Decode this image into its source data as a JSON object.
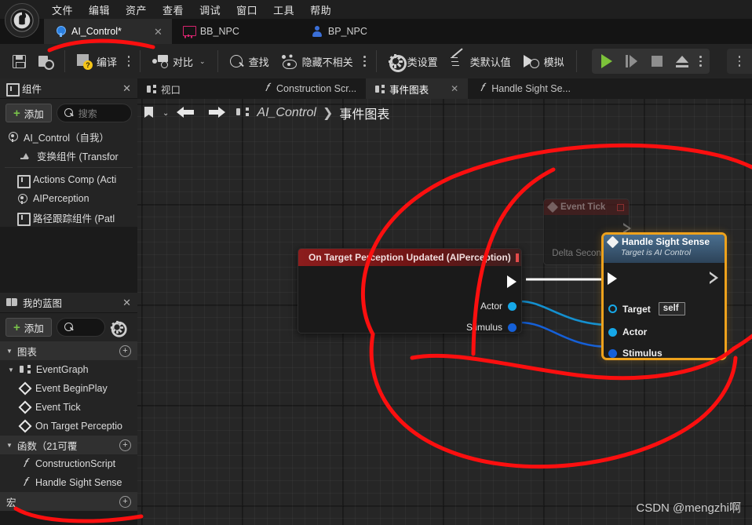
{
  "app": {
    "logo_icon": "unreal-engine-logo"
  },
  "menubar": {
    "items": [
      {
        "label": "文件"
      },
      {
        "label": "编辑"
      },
      {
        "label": "资产"
      },
      {
        "label": "查看"
      },
      {
        "label": "调试"
      },
      {
        "label": "窗口"
      },
      {
        "label": "工具"
      },
      {
        "label": "帮助"
      }
    ]
  },
  "asset_tabs": [
    {
      "label": "AI_Control*",
      "icon": "blueprint-sphere-icon",
      "active": true,
      "close": "✕"
    },
    {
      "label": "BB_NPC",
      "icon": "blackboard-icon",
      "active": false
    },
    {
      "label": "BP_NPC",
      "icon": "character-icon",
      "active": false
    }
  ],
  "toolbar": {
    "save_label": "",
    "browse_label": "",
    "compile_label": "编译",
    "diff_label": "对比",
    "find_label": "查找",
    "hide_unrelated_label": "隐藏不相关",
    "class_settings_label": "类设置",
    "class_defaults_label": "类默认值",
    "simulate_label": "模拟",
    "icons": {
      "save": "save-icon",
      "browse": "browse-icon",
      "compile": "compile-icon",
      "diff": "diff-icon",
      "find": "find-icon",
      "hide": "hide-unrelated-icon",
      "gear": "gear-icon",
      "pencil": "pencil-icon",
      "simulate": "simulate-icon",
      "play": "play-icon",
      "step": "step-icon",
      "stop": "stop-icon",
      "eject": "eject-icon"
    },
    "caret": "⌄"
  },
  "components_panel": {
    "title": "组件",
    "close": "✕",
    "add_label": "添加",
    "add_plus": "+",
    "search_placeholder": "搜索",
    "items": [
      {
        "label": "AI_Control（自我）",
        "icon": "blueprint-sphere-icon",
        "indent": 0
      },
      {
        "label": "变换组件 (Transfor",
        "icon": "transform-icon",
        "indent": 1
      },
      {
        "label": "Actions Comp (Acti",
        "icon": "component-icon",
        "indent": 1
      },
      {
        "label": "AIPerception",
        "icon": "perception-icon",
        "indent": 1
      },
      {
        "label": "路径跟踪组件 (Patl",
        "icon": "component-icon",
        "indent": 1
      }
    ]
  },
  "myblueprint_panel": {
    "title": "我的蓝图",
    "close": "✕",
    "add_label": "添加",
    "add_plus": "+",
    "search_placeholder": "",
    "settings_icon": "gear-icon",
    "sections": [
      {
        "label": "图表",
        "arrow": "▼",
        "add": "+",
        "items": [
          {
            "label": "EventGraph",
            "icon": "graph-icon",
            "indent": 0,
            "arrow": "▼"
          },
          {
            "label": "Event BeginPlay",
            "icon": "event-diamond-icon",
            "indent": 1
          },
          {
            "label": "Event Tick",
            "icon": "event-diamond-icon",
            "indent": 1
          },
          {
            "label": "On Target Perceptio",
            "icon": "event-diamond-icon",
            "indent": 1
          }
        ]
      },
      {
        "label": "函数（21可覆",
        "arrow": "▼",
        "add": "+",
        "items": [
          {
            "label": "ConstructionScript",
            "icon": "function-icon",
            "indent": 1
          },
          {
            "label": "Handle Sight Sense",
            "icon": "function-icon",
            "indent": 1,
            "selected": true
          }
        ]
      },
      {
        "label": "宏",
        "arrow": "",
        "add": "+",
        "items": []
      }
    ]
  },
  "graph_tabs": [
    {
      "label": "视口",
      "icon": "viewport-icon",
      "active": false
    },
    {
      "label": "Construction Scr...",
      "icon": "function-icon",
      "active": false
    },
    {
      "label": "事件图表",
      "icon": "graph-icon",
      "active": true,
      "close": "✕"
    },
    {
      "label": "Handle Sight Se...",
      "icon": "function-icon",
      "active": false
    }
  ],
  "graph_header": {
    "bookmark_icon": "bookmark-icon",
    "caret": "⌄",
    "back_icon": "arrow-left-icon",
    "forward_icon": "arrow-right-icon",
    "breadcrumb_icon": "graph-icon",
    "breadcrumb_root": "AI_Control",
    "breadcrumb_sep": "❯",
    "breadcrumb_current": "事件图表"
  },
  "graph_nodes": {
    "ghost_event_tick": {
      "title": "Event Tick",
      "pin_delta": "Delta Seconds"
    },
    "event_node": {
      "title": "On Target Perception Updated (AIPerception)",
      "out_pins": [
        {
          "label": "Actor",
          "color": "#16a8e8"
        },
        {
          "label": "Stimulus",
          "color": "#1560d8"
        }
      ]
    },
    "function_node": {
      "title": "Handle Sight Sense",
      "subtitle": "Target is AI Control",
      "in_pins": [
        {
          "label": "Target",
          "value": "self",
          "color": "#16a8e8"
        },
        {
          "label": "Actor",
          "color": "#16a8e8"
        },
        {
          "label": "Stimulus",
          "color": "#1560d8"
        }
      ]
    }
  },
  "annotation": {
    "color": "#fb0f0f"
  },
  "watermark": "CSDN @mengzhi啊",
  "colors": {
    "accent_orange": "#eea21c",
    "event_red": "#8c1d1d",
    "function_blue": "#4a6f8f",
    "pin_cyan": "#16a8e8",
    "pin_blue": "#1560d8",
    "play_green": "#7cc23a",
    "annotation_red": "#fb0f0f"
  }
}
